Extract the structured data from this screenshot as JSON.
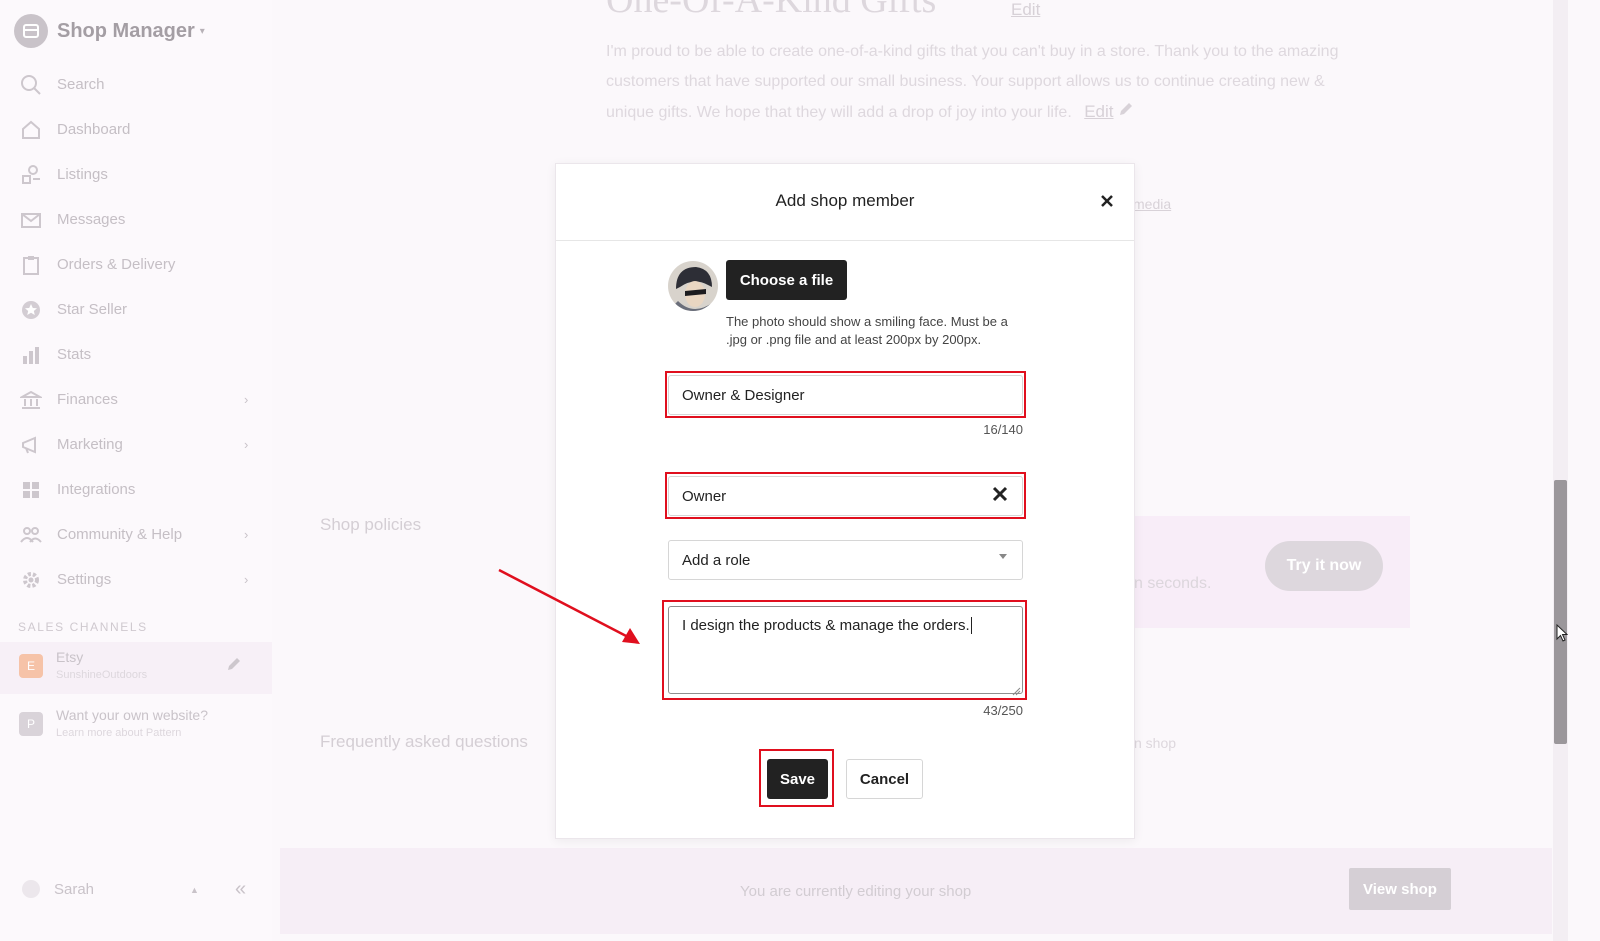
{
  "sidebar": {
    "brand": "Shop Manager",
    "items": [
      {
        "label": "Search",
        "icon": "search-icon"
      },
      {
        "label": "Dashboard",
        "icon": "home-icon"
      },
      {
        "label": "Listings",
        "icon": "listings-icon"
      },
      {
        "label": "Messages",
        "icon": "mail-icon"
      },
      {
        "label": "Orders & Delivery",
        "icon": "clipboard-icon"
      },
      {
        "label": "Star Seller",
        "icon": "star-icon"
      },
      {
        "label": "Stats",
        "icon": "bar-chart-icon"
      },
      {
        "label": "Finances",
        "icon": "bank-icon"
      },
      {
        "label": "Marketing",
        "icon": "megaphone-icon"
      },
      {
        "label": "Integrations",
        "icon": "grid-icon"
      },
      {
        "label": "Community & Help",
        "icon": "people-icon"
      },
      {
        "label": "Settings",
        "icon": "gear-icon"
      }
    ],
    "sales_channels_title": "SALES CHANNELS",
    "channels": [
      {
        "title": "Etsy",
        "subtitle": "SunshineOutdoors",
        "avatar": "E"
      },
      {
        "title": "Want your own website?",
        "subtitle": "Learn more about Pattern",
        "avatar": "P"
      }
    ],
    "user": "Sarah"
  },
  "background": {
    "shop_title": "One-Of-A-Kind Gifts",
    "edit_label": "Edit",
    "description": "I'm proud to be able to create one-of-a-kind gifts that you can't buy in a store. Thank you to the amazing customers that have supported our small business. Your support allows us to continue creating new & unique gifts. We hope that they will add a drop of joy into your life.",
    "media_link": "media",
    "shop_policies": "Shop policies",
    "faq": "Frequently asked questions",
    "promo_text": "n seconds.",
    "try_now": "Try it now",
    "shop_fragment": "n shop",
    "footer_message": "You are currently editing your shop",
    "view_shop": "View shop"
  },
  "modal": {
    "title": "Add shop member",
    "choose_file": "Choose a file",
    "photo_hint": "The photo should show a smiling face. Must be a .jpg or .png file and at least 200px by 200px.",
    "role_title_value": "Owner & Designer",
    "role_title_counter": "16/140",
    "role_tag": "Owner",
    "add_role_placeholder": "Add a role",
    "bio_value": "I design the products & manage the orders. ",
    "bio_counter": "43/250",
    "save": "Save",
    "cancel": "Cancel"
  },
  "colors": {
    "highlight": "#e00f1e",
    "primary_button": "#222222"
  }
}
